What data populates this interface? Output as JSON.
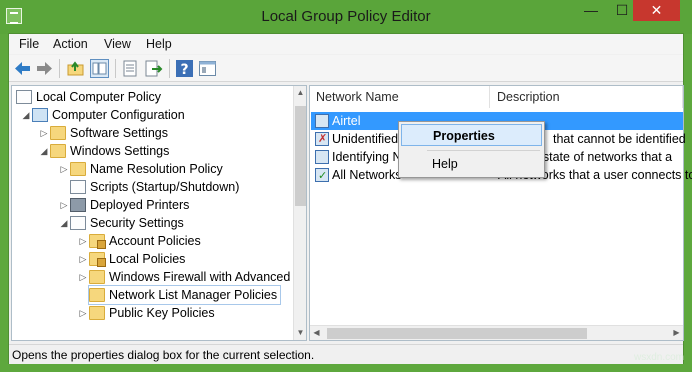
{
  "window": {
    "title": "Local Group Policy Editor",
    "min_glyph": "—",
    "max_glyph": "☐",
    "close_glyph": "✕"
  },
  "menu": {
    "file": "File",
    "action": "Action",
    "view": "View",
    "help": "Help"
  },
  "toolbar": {
    "icons": [
      "back-icon",
      "forward-icon",
      "up-folder-icon",
      "show-hide-tree-icon",
      "export-list-icon",
      "export-icon",
      "help-icon",
      "console-view-icon"
    ]
  },
  "tree": {
    "root": "Local Computer Policy",
    "computer_config": "Computer Configuration",
    "software_settings": "Software Settings",
    "windows_settings": "Windows Settings",
    "name_resolution": "Name Resolution Policy",
    "scripts": "Scripts (Startup/Shutdown)",
    "deployed_printers": "Deployed Printers",
    "security_settings": "Security Settings",
    "account_policies": "Account Policies",
    "local_policies": "Local Policies",
    "windows_firewall": "Windows Firewall with Advanced",
    "network_list": "Network List Manager Policies",
    "public_key": "Public Key Policies"
  },
  "list": {
    "col_name": "Network Name",
    "col_desc": "Description",
    "rows": [
      {
        "name": "Airtel",
        "desc": ""
      },
      {
        "name": "Unidentified",
        "desc": "that cannot be identified"
      },
      {
        "name": "Identifying N",
        "desc": "ry state of networks that a"
      },
      {
        "name": "All Networks",
        "desc": "All networks that a user connects to"
      }
    ]
  },
  "context_menu": {
    "properties": "Properties",
    "help": "Help"
  },
  "status": {
    "text": "Opens the properties dialog box for the current selection."
  },
  "watermark": "wsxdn.com",
  "colors": {
    "title_bg": "#5aa53a",
    "close_bg": "#c7372e",
    "selection": "#3399ff"
  }
}
